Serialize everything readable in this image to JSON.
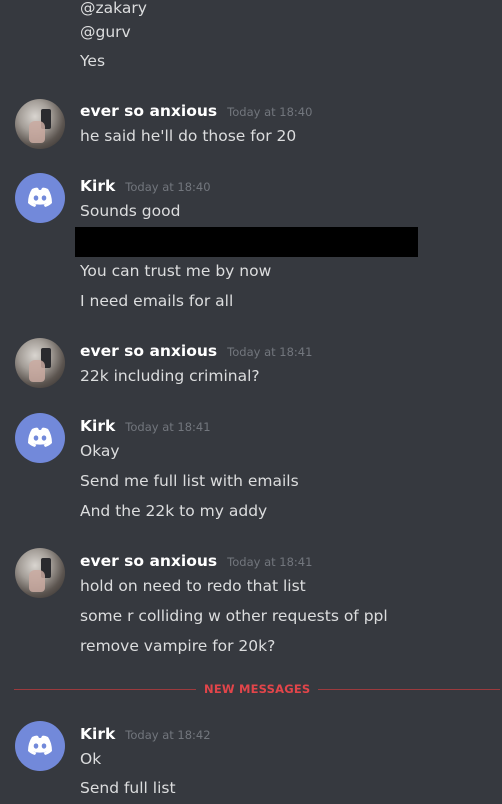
{
  "colors": {
    "background": "#36393f",
    "text": "#dcddde",
    "username": "#ffffff",
    "timestamp": "#72767d",
    "discord_blurple": "#7289da",
    "new_messages_red": "#e2454a"
  },
  "top_lines": [
    "@zakary",
    "@gurv",
    "Yes"
  ],
  "groups": [
    {
      "avatar": "photo-avatar",
      "username": "ever so anxious",
      "timestamp": "Today at 18:40",
      "messages": [
        "he said he'll do those for 20"
      ]
    },
    {
      "avatar": "discord-logo-icon",
      "username": "Kirk",
      "timestamp": "Today at 18:40",
      "messages": [
        "Sounds good",
        "You can trust me by now",
        "I need emails for all"
      ]
    },
    {
      "avatar": "photo-avatar",
      "username": "ever so anxious",
      "timestamp": "Today at 18:41",
      "messages": [
        "22k including criminal?"
      ]
    },
    {
      "avatar": "discord-logo-icon",
      "username": "Kirk",
      "timestamp": "Today at 18:41",
      "messages": [
        "Okay",
        "Send me full list with emails",
        "And the 22k to my addy"
      ]
    },
    {
      "avatar": "photo-avatar",
      "username": "ever so anxious",
      "timestamp": "Today at 18:41",
      "messages": [
        "hold on need to redo that list",
        "some r colliding w other requests of ppl",
        "remove vampire for 20k?"
      ]
    },
    {
      "avatar": "discord-logo-icon",
      "username": "Kirk",
      "timestamp": "Today at 18:42",
      "messages": [
        "Ok",
        "Send full list"
      ]
    }
  ],
  "divider": {
    "label": "NEW MESSAGES"
  }
}
